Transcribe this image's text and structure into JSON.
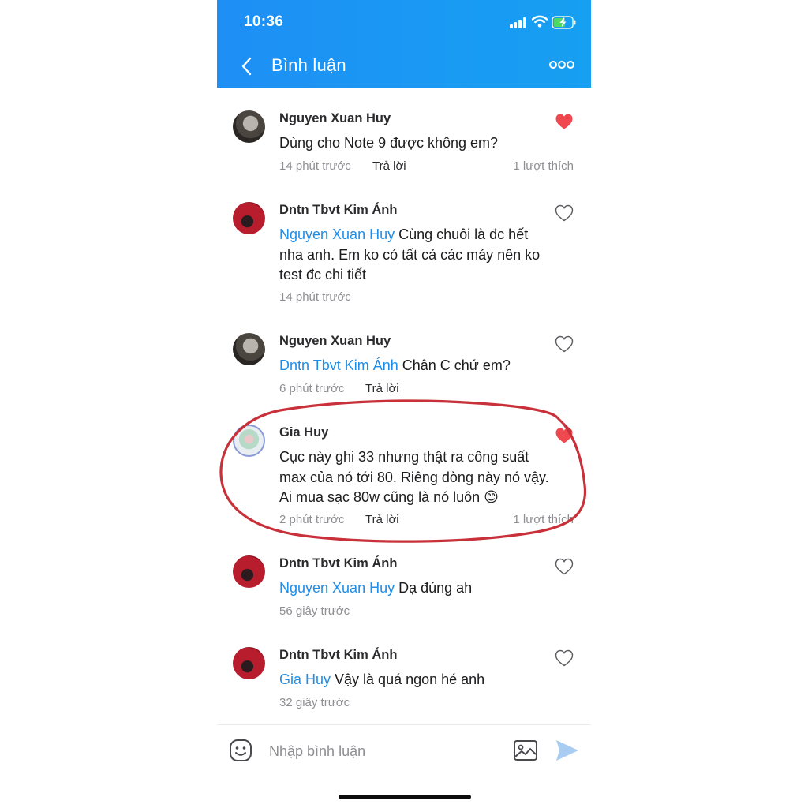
{
  "status_bar": {
    "time": "10:36"
  },
  "header": {
    "title": "Bình luận"
  },
  "comments": [
    {
      "name": "Nguyen Xuan Huy",
      "mention": "",
      "text": "Dùng cho Note 9 được không em?",
      "time": "14 phút trước",
      "reply_label": "Trả lời",
      "likes": "1 lượt thích",
      "liked": true
    },
    {
      "name": "Dntn Tbvt Kim Ánh",
      "mention": "Nguyen Xuan Huy",
      "text": " Cùng chuôi là đc hết nha anh. Em ko có tất cả các máy nên ko test đc chi tiết",
      "time": "14 phút trước",
      "reply_label": "",
      "likes": "",
      "liked": false
    },
    {
      "name": "Nguyen Xuan Huy",
      "mention": "Dntn Tbvt Kim Ánh",
      "text": " Chân C chứ em?",
      "time": "6 phút trước",
      "reply_label": "Trả lời",
      "likes": "",
      "liked": false
    },
    {
      "name": "Gia Huy",
      "mention": "",
      "text": "Cục này ghi 33 nhưng thật ra công suất max của nó tới 80. Riêng dòng này nó vậy. Ai mua sạc 80w cũng là nó luôn 😊",
      "time": "2 phút trước",
      "reply_label": "Trả lời",
      "likes": "1 lượt thích",
      "liked": true
    },
    {
      "name": "Dntn Tbvt Kim Ánh",
      "mention": "Nguyen Xuan Huy",
      "text": " Dạ đúng ah",
      "time": "56 giây trước",
      "reply_label": "",
      "likes": "",
      "liked": false
    },
    {
      "name": "Dntn Tbvt Kim Ánh",
      "mention": "Gia Huy",
      "text": " Vậy là quá ngon hé anh",
      "time": "32 giây trước",
      "reply_label": "",
      "likes": "",
      "liked": false
    }
  ],
  "composer": {
    "placeholder": "Nhập bình luận"
  },
  "colors": {
    "header": "#1e8ff5",
    "mention": "#1f8ee8",
    "heart_liked": "#f0484f",
    "annotation": "#c8303a"
  },
  "icons": {
    "back": "chevron-left-icon",
    "more": "more-dots-icon",
    "heart": "heart-icon",
    "emoji": "emoji-icon",
    "image": "image-icon",
    "send": "send-icon"
  }
}
